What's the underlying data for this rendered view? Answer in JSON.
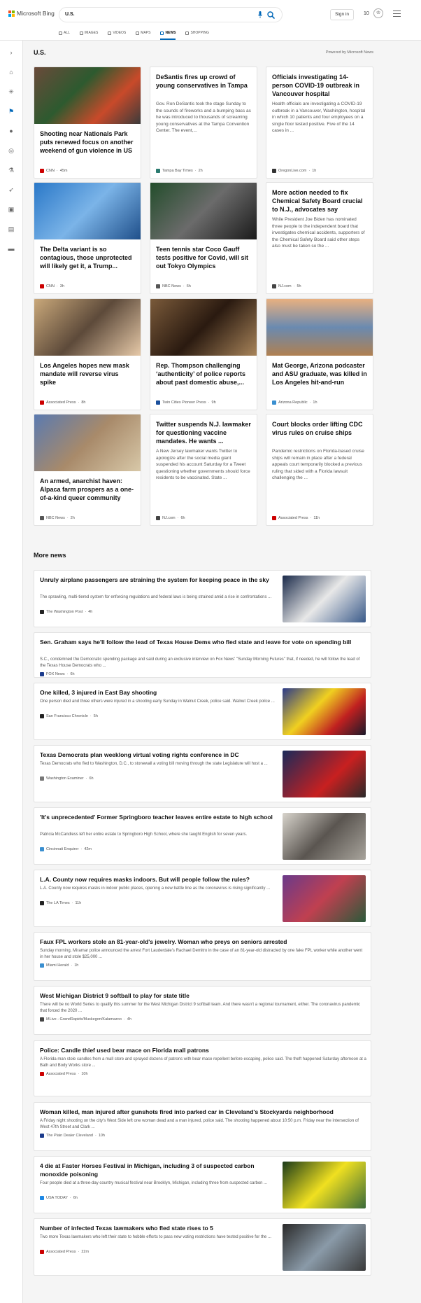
{
  "header": {
    "logo_text": "Microsoft Bing",
    "query": "U.S.",
    "signin": "Sign in",
    "points": "10"
  },
  "tabs": [
    "ALL",
    "IMAGES",
    "VIDEOS",
    "MAPS",
    "NEWS",
    "SHOPPING"
  ],
  "active_tab": "NEWS",
  "section": {
    "title": "U.S.",
    "powered": "Powered by Microsoft News"
  },
  "cards": [
    {
      "title": "Shooting near Nationals Park puts renewed focus on another weekend of gun violence in US",
      "source": "CNN",
      "time": "45m",
      "icon_color": "#cc0000"
    },
    {
      "title": "DeSantis fires up crowd of young conservatives in Tampa",
      "desc": "Gov. Ron DeSantis took the stage Sunday to the sounds of fireworks and a bumping bass as he was introduced to thousands of screaming young conservatives at the Tampa Convention Center. The event,...",
      "source": "Tampa Bay Times",
      "time": "2h",
      "icon_color": "#2a7a6f"
    },
    {
      "title": "Officials investigating 14-person COVID-19 outbreak in Vancouver hospital",
      "desc": "Health officials are investigating a COVID-19 outbreak in a Vancouver, Washington, hospital in which 10 patients and four employees on a single floor tested positive. Five of the 14 cases in ...",
      "source": "OregonLive.com",
      "time": "1h",
      "icon_color": "#333333"
    },
    {
      "title": "The Delta variant is so contagious, those unprotected will likely get it, a Trump...",
      "source": "CNN",
      "time": "3h",
      "icon_color": "#cc0000"
    },
    {
      "title": "Teen tennis star Coco Gauff tests positive for Covid, will sit out Tokyo Olympics",
      "source": "NBC News",
      "time": "6h",
      "icon_color": "#555555"
    },
    {
      "title": "More action needed to fix Chemical Safety Board crucial to N.J., advocates say",
      "desc": "While President Joe Biden has nominated three people to the independent board that investigates chemical accidents, supporters of the Chemical Safety Board said other steps also must be taken so the ...",
      "source": "NJ.com",
      "time": "5h",
      "icon_color": "#444444"
    },
    {
      "title": "Los Angeles hopes new mask mandate will reverse virus spike",
      "source": "Associated Press",
      "time": "8h",
      "icon_color": "#cc0000"
    },
    {
      "title": "Rep. Thompson challenging ‘authenticity’ of police reports about past domestic abuse,...",
      "source": "Twin Cities Pioneer Press",
      "time": "9h",
      "icon_color": "#1a4f9c"
    },
    {
      "title": "Mat George, Arizona podcaster and ASU graduate, was killed in Los Angeles hit-and-run",
      "source": "Arizona Republic",
      "time": "1h",
      "icon_color": "#3a8fd0"
    },
    {
      "title": "An armed, anarchist haven: Alpaca farm prospers as a one-of-a-kind queer community",
      "source": "NBC News",
      "time": "2h",
      "icon_color": "#555555"
    },
    {
      "title": "Twitter suspends N.J. lawmaker for questioning vaccine mandates. He wants ...",
      "desc": "A New Jersey lawmaker wants Twitter to apologize after the social media giant suspended his account Saturday for a Tweet questioning whether governments should force residents to be vaccinated. State ...",
      "source": "NJ.com",
      "time": "6h",
      "icon_color": "#444444"
    },
    {
      "title": "Court blocks order lifting CDC virus rules on cruise ships",
      "desc": "Pandemic restrictions on Florida-based cruise ships will remain in place after a federal appeals court temporarily blocked a previous ruling that sided with a Florida lawsuit challenging the ...",
      "source": "Associated Press",
      "time": "11h",
      "icon_color": "#cc0000"
    }
  ],
  "more_news": {
    "title": "More news",
    "items": [
      {
        "title": "Unruly airplane passengers are straining the system for keeping peace in the sky",
        "desc": "The sprawling, multi-tiered system for enforcing regulations and federal laws is being strained amid a rise in confrontations ...",
        "source": "The Washington Post",
        "time": "4h",
        "icon_color": "#222222",
        "has_image": true
      },
      {
        "title": "Sen. Graham says he'll follow the lead of Texas House Dems who fled state and leave for vote on spending bill",
        "desc": "S.C., condemned the Democratic spending package and said during an exclusive interview on Fox News' \"Sunday Morning Futures\" that, if needed, he will follow the lead of the Texas House Democrats who ...",
        "source": "FOX News",
        "time": "6h",
        "icon_color": "#1b3b8c",
        "has_image": false
      },
      {
        "title": "One killed, 3 injured in East Bay shooting",
        "desc": "One person died and three others were injured in a shooting early Sunday in Walnut Creek, police said. Walnut Creek police ...",
        "source": "San Francisco Chronicle",
        "time": "5h",
        "icon_color": "#222222",
        "has_image": true
      },
      {
        "title": "Texas Democrats plan weeklong virtual voting rights conference in DC",
        "desc": "Texas Democrats who fled to Washington, D.C., to stonewall a voting bill moving through the state Legislature will host a ...",
        "source": "Washington Examiner",
        "time": "6h",
        "icon_color": "#777777",
        "has_image": true
      },
      {
        "title": "'It's unprecedented' Former Springboro teacher leaves entire estate to high school",
        "desc": "Patricia McCandless left her entire estate to Springboro High School, where she taught English for seven years.",
        "source": "Cincinnati Enquirer",
        "time": "42m",
        "icon_color": "#3a8fd0",
        "has_image": true
      },
      {
        "title": "L.A. County now requires masks indoors. But will people follow the rules?",
        "desc": "L.A. County now requires masks in indoor public places, opening a new battle line as the coronavirus is rising significantly ...",
        "source": "The LA Times",
        "time": "11h",
        "icon_color": "#222222",
        "has_image": true
      },
      {
        "title": "Faux FPL workers stole an 81-year-old's jewelry. Woman who preys on seniors arrested",
        "desc": "Sunday morning, Miramar police announced the arrest Fort Lauderdale's Rachael Demitro in the case of an 81-year-old distracted by one fake FPL worker while another went in her house and stole $25,000 ...",
        "source": "Miami Herald",
        "time": "1h",
        "icon_color": "#3a8fd0",
        "has_image": false
      },
      {
        "title": "West Michigan District 9 softball to play for state title",
        "desc": "There will be no World Series to qualify this summer for the West Michigan District 9 softball team. And there wasn't a regional tournament, either. The coronavirus pandemic that forced the 2020 ...",
        "source": "MLive - GrandRapids/Muskegon/Kalamazoo",
        "time": "4h",
        "icon_color": "#444444",
        "has_image": false
      },
      {
        "title": "Police: Candle thief used bear mace on Florida mall patrons",
        "desc": "A Florida man stole candles from a mall store and sprayed dozens of patrons with bear mace repellent before escaping, police said. The theft happened Saturday afternoon at a Bath and Body Works store ...",
        "source": "Associated Press",
        "time": "10h",
        "icon_color": "#cc0000",
        "has_image": false
      },
      {
        "title": "Woman killed, man injured after gunshots fired into parked car in Cleveland's Stockyards neighborhood",
        "desc": "A Friday night shooting on the city's West Side left one woman dead and a man injured, police said. The shooting happened about 10:50 p.m. Friday near the intersection of West 47th Street and Clark ...",
        "source": "The Plain Dealer Cleveland",
        "time": "10h",
        "icon_color": "#1b3b8c",
        "has_image": false
      },
      {
        "title": "4 die at Faster Horses Festival in Michigan, including 3 of suspected carbon monoxide poisoning",
        "desc": "Four people died at a three-day country musical festival near Brooklyn, Michigan, including three from suspected carbon ...",
        "source": "USA TODAY",
        "time": "6h",
        "icon_color": "#1e88e5",
        "has_image": true
      },
      {
        "title": "Number of infected Texas lawmakers who fled state rises to 5",
        "desc": "Two more Texas lawmakers who left their state to hobble efforts to pass new voting restrictions have tested positive for the ...",
        "source": "Associated Press",
        "time": "22m",
        "icon_color": "#cc0000",
        "has_image": true
      }
    ]
  }
}
